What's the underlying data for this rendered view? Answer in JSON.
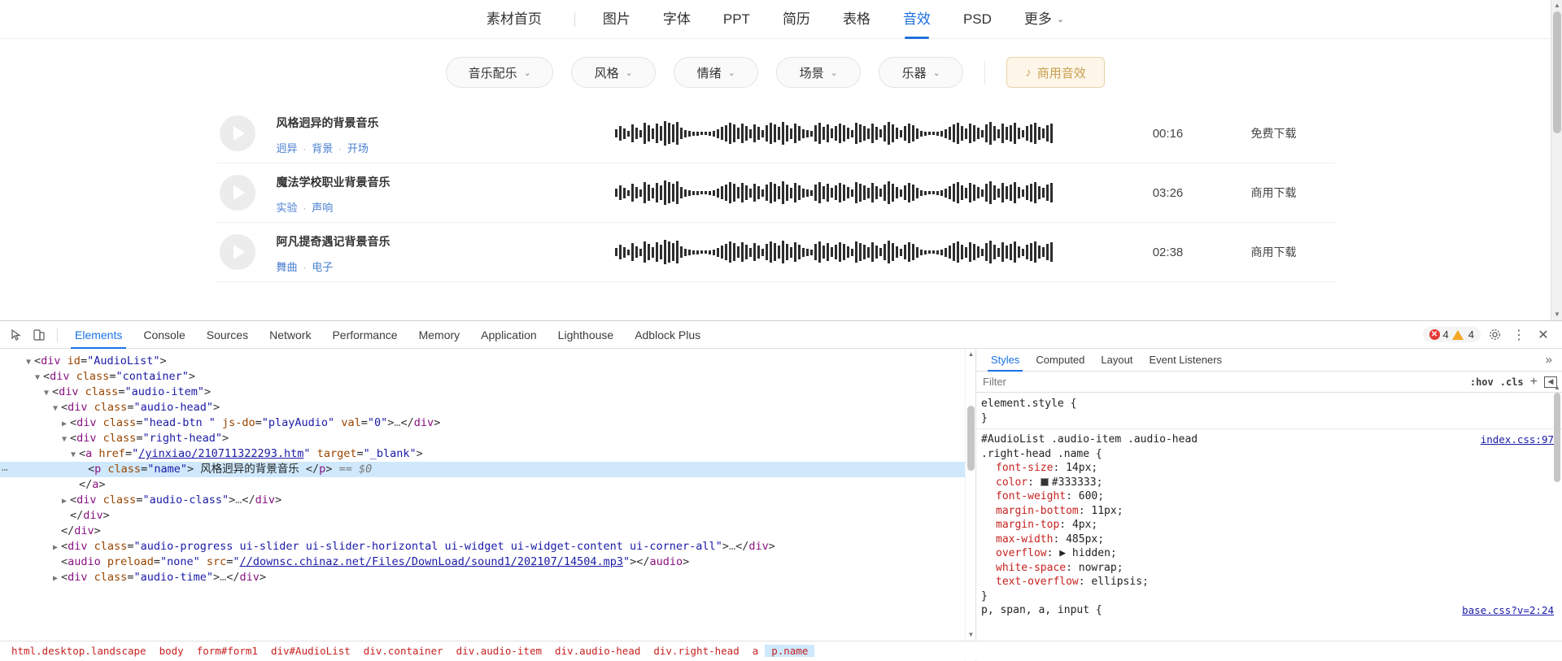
{
  "nav": {
    "items": [
      {
        "label": "素材首页",
        "active": false,
        "caret": false
      },
      {
        "label": "图片",
        "active": false,
        "caret": false
      },
      {
        "label": "字体",
        "active": false,
        "caret": false
      },
      {
        "label": "PPT",
        "active": false,
        "caret": false
      },
      {
        "label": "简历",
        "active": false,
        "caret": false
      },
      {
        "label": "表格",
        "active": false,
        "caret": false
      },
      {
        "label": "音效",
        "active": true,
        "caret": false
      },
      {
        "label": "PSD",
        "active": false,
        "caret": false
      },
      {
        "label": "更多",
        "active": false,
        "caret": true
      }
    ],
    "caret_glyph": "⌄"
  },
  "filters": {
    "chips": [
      {
        "label": "音乐配乐"
      },
      {
        "label": "风格"
      },
      {
        "label": "情绪"
      },
      {
        "label": "场景"
      },
      {
        "label": "乐器"
      }
    ],
    "caret_glyph": "⌄",
    "commercial_button": {
      "label": "商用音效",
      "icon": "music-note-icon",
      "glyph": "♪",
      "color": "#c9a050",
      "bg": "#fdf6e9"
    }
  },
  "audio_list": {
    "items": [
      {
        "name": "风格迥异的背景音乐",
        "tags": [
          "迥异",
          "背景",
          "开场"
        ],
        "duration": "00:16",
        "download": "免费下载"
      },
      {
        "name": "魔法学校职业背景音乐",
        "tags": [
          "实验",
          "声响"
        ],
        "duration": "03:26",
        "download": "商用下载"
      },
      {
        "name": "阿凡提奇遇记背景音乐",
        "tags": [
          "舞曲",
          "电子"
        ],
        "duration": "02:38",
        "download": "商用下载"
      }
    ],
    "tag_separator": "·",
    "play_icon": "play-icon"
  },
  "devtools": {
    "inspect_icon": "inspect-element-icon",
    "device_icon": "device-toolbar-icon",
    "tabs": [
      {
        "label": "Elements",
        "active": true
      },
      {
        "label": "Console",
        "active": false
      },
      {
        "label": "Sources",
        "active": false
      },
      {
        "label": "Network",
        "active": false
      },
      {
        "label": "Performance",
        "active": false
      },
      {
        "label": "Memory",
        "active": false
      },
      {
        "label": "Application",
        "active": false
      },
      {
        "label": "Lighthouse",
        "active": false
      },
      {
        "label": "Adblock Plus",
        "active": false
      }
    ],
    "errors": {
      "error_count": "4",
      "warning_count": "4",
      "error_glyph": "✕"
    },
    "settings_icon": "gear-icon",
    "more_icon": "kebab-menu-icon",
    "close_icon": "close-icon",
    "dom": {
      "lines": [
        {
          "indent": 2,
          "tri": "▼",
          "html": "<span class=\"punc\">&lt;</span><span class=\"tag\">div</span> <span class=\"attr\">id</span>=<span class=\"val\">\"AudioList\"</span><span class=\"punc\">&gt;</span>"
        },
        {
          "indent": 3,
          "tri": "▼",
          "html": "<span class=\"punc\">&lt;</span><span class=\"tag\">div</span> <span class=\"attr\">class</span>=<span class=\"val\">\"container\"</span><span class=\"punc\">&gt;</span>"
        },
        {
          "indent": 4,
          "tri": "▼",
          "html": "<span class=\"punc\">&lt;</span><span class=\"tag\">div</span> <span class=\"attr\">class</span>=<span class=\"val\">\"audio-item\"</span><span class=\"punc\">&gt;</span>"
        },
        {
          "indent": 5,
          "tri": "▼",
          "html": "<span class=\"punc\">&lt;</span><span class=\"tag\">div</span> <span class=\"attr\">class</span>=<span class=\"val\">\"audio-head\"</span><span class=\"punc\">&gt;</span>"
        },
        {
          "indent": 6,
          "tri": "▶",
          "html": "<span class=\"punc\">&lt;</span><span class=\"tag\">div</span> <span class=\"attr\">class</span>=<span class=\"val\">\"head-btn \"</span> <span class=\"attr\">js-do</span>=<span class=\"val\">\"playAudio\"</span> <span class=\"attr\">val</span>=<span class=\"val\">\"0\"</span><span class=\"punc\">&gt;</span><span class=\"ellip\">…</span><span class=\"punc\">&lt;/</span><span class=\"tag\">div</span><span class=\"punc\">&gt;</span>"
        },
        {
          "indent": 6,
          "tri": "▼",
          "html": "<span class=\"punc\">&lt;</span><span class=\"tag\">div</span> <span class=\"attr\">class</span>=<span class=\"val\">\"right-head\"</span><span class=\"punc\">&gt;</span>"
        },
        {
          "indent": 7,
          "tri": "▼",
          "html": "<span class=\"punc\">&lt;</span><span class=\"tag\">a</span> <span class=\"attr\">href</span>=<span class=\"val\">\"</span><span class=\"lnk\">/yinxiao/210711322293.htm</span><span class=\"val\">\"</span> <span class=\"attr\">target</span>=<span class=\"val\">\"_blank\"</span><span class=\"punc\">&gt;</span>"
        },
        {
          "indent": 8,
          "tri": "",
          "sel": true,
          "dots": "⋯",
          "html": "<span class=\"punc\">&lt;</span><span class=\"tag\">p</span> <span class=\"attr\">class</span>=<span class=\"val\">\"name\"</span><span class=\"punc\">&gt;</span> <span class=\"txt\">风格迥异的背景音乐</span> <span class=\"punc\">&lt;/</span><span class=\"tag\">p</span><span class=\"punc\">&gt;</span> <span class=\"dollar\">== $0</span>"
        },
        {
          "indent": 7,
          "tri": "",
          "html": "<span class=\"punc\">&lt;/</span><span class=\"tag\">a</span><span class=\"punc\">&gt;</span>"
        },
        {
          "indent": 6,
          "tri": "▶",
          "html": "<span class=\"punc\">&lt;</span><span class=\"tag\">div</span> <span class=\"attr\">class</span>=<span class=\"val\">\"audio-class\"</span><span class=\"punc\">&gt;</span><span class=\"ellip\">…</span><span class=\"punc\">&lt;/</span><span class=\"tag\">div</span><span class=\"punc\">&gt;</span>"
        },
        {
          "indent": 6,
          "tri": "",
          "html": "<span class=\"punc\">&lt;/</span><span class=\"tag\">div</span><span class=\"punc\">&gt;</span>"
        },
        {
          "indent": 5,
          "tri": "",
          "html": "<span class=\"punc\">&lt;/</span><span class=\"tag\">div</span><span class=\"punc\">&gt;</span>"
        },
        {
          "indent": 5,
          "tri": "▶",
          "html": "<span class=\"punc\">&lt;</span><span class=\"tag\">div</span> <span class=\"attr\">class</span>=<span class=\"val\">\"audio-progress ui-slider ui-slider-horizontal ui-widget ui-widget-content ui-corner-all\"</span><span class=\"punc\">&gt;</span><span class=\"ellip\">…</span><span class=\"punc\">&lt;/</span><span class=\"tag\">div</span><span class=\"punc\">&gt;</span>"
        },
        {
          "indent": 5,
          "tri": "",
          "html": "<span class=\"punc\">&lt;</span><span class=\"tag\">audio</span> <span class=\"attr\">preload</span>=<span class=\"val\">\"none\"</span> <span class=\"attr\">src</span>=<span class=\"val\">\"</span><span class=\"lnk\">//downsc.chinaz.net/Files/DownLoad/sound1/202107/14504.mp3</span><span class=\"val\">\"</span><span class=\"punc\">&gt;&lt;/</span><span class=\"tag\">audio</span><span class=\"punc\">&gt;</span>"
        },
        {
          "indent": 5,
          "tri": "▶",
          "html": "<span class=\"punc\">&lt;</span><span class=\"tag\">div</span> <span class=\"attr\">class</span>=<span class=\"val\">\"audio-time\"</span><span class=\"punc\">&gt;</span><span class=\"ellip\">…</span><span class=\"punc\">&lt;/</span><span class=\"tag\">div</span><span class=\"punc\">&gt;</span>"
        }
      ]
    },
    "breadcrumb": [
      {
        "label": "html.desktop.landscape",
        "selected": false
      },
      {
        "label": "body",
        "selected": false
      },
      {
        "label": "form#form1",
        "selected": false
      },
      {
        "label": "div#AudioList",
        "selected": false
      },
      {
        "label": "div.container",
        "selected": false
      },
      {
        "label": "div.audio-item",
        "selected": false
      },
      {
        "label": "div.audio-head",
        "selected": false
      },
      {
        "label": "div.right-head",
        "selected": false
      },
      {
        "label": "a",
        "selected": false
      },
      {
        "label": "p.name",
        "selected": true
      }
    ],
    "styles": {
      "tabs": [
        {
          "label": "Styles",
          "active": true
        },
        {
          "label": "Computed",
          "active": false
        },
        {
          "label": "Layout",
          "active": false
        },
        {
          "label": "Event Listeners",
          "active": false
        }
      ],
      "more_glyph": "»",
      "filter_placeholder": "Filter",
      "hov_label": ":hov",
      "cls_label": ".cls",
      "plus_glyph": "+",
      "sidebar_toggle_glyph": "◀",
      "element_style_text": "element.style {",
      "element_style_close": "}",
      "rule": {
        "selector": "#AudioList .audio-item .audio-head .right-head .name {",
        "source": "index.css:97",
        "close": "}",
        "properties": [
          {
            "name": "font-size",
            "value": "14px",
            "swatch": null
          },
          {
            "name": "color",
            "value": "#333333",
            "swatch": "#333333"
          },
          {
            "name": "font-weight",
            "value": "600",
            "swatch": null
          },
          {
            "name": "margin-bottom",
            "value": "11px",
            "swatch": null
          },
          {
            "name": "margin-top",
            "value": "4px",
            "swatch": null
          },
          {
            "name": "max-width",
            "value": "485px",
            "swatch": null
          },
          {
            "name": "overflow",
            "value": "▶ hidden",
            "swatch": null
          },
          {
            "name": "white-space",
            "value": "nowrap",
            "swatch": null
          },
          {
            "name": "text-overflow",
            "value": "ellipsis",
            "swatch": null
          }
        ]
      },
      "next_rule_selector": "p, span, a, input {",
      "next_rule_source": "base.css?v=2:24"
    }
  },
  "waveform": {
    "heights": [
      10,
      18,
      13,
      7,
      22,
      14,
      9,
      26,
      20,
      13,
      24,
      18,
      30,
      26,
      22,
      28,
      14,
      9,
      7,
      5,
      5,
      4,
      4,
      5,
      7,
      11,
      16,
      20,
      26,
      22,
      14,
      24,
      18,
      11,
      22,
      16,
      9,
      20,
      26,
      22,
      16,
      28,
      20,
      13,
      24,
      18,
      11,
      9,
      7,
      20,
      26,
      16,
      22,
      12,
      18,
      24,
      20,
      14,
      9,
      26,
      22,
      18,
      13,
      24,
      16,
      10,
      20,
      28,
      22,
      14,
      9,
      18,
      24,
      20,
      13,
      7,
      5,
      4,
      4,
      5,
      7,
      11,
      16,
      22,
      26,
      18,
      13,
      24,
      20,
      14,
      9,
      22,
      28,
      18,
      11,
      24,
      16,
      20,
      26,
      14,
      9,
      18,
      22,
      26,
      16,
      12,
      20,
      24
    ]
  }
}
